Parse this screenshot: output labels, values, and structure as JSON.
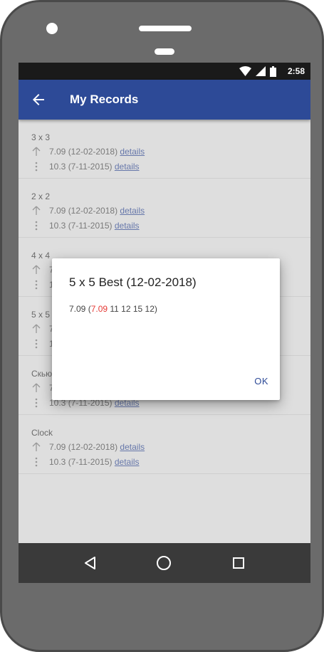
{
  "status_bar": {
    "time": "2:58",
    "icons": [
      "wifi-icon",
      "signal-icon",
      "battery-icon"
    ]
  },
  "app_bar": {
    "title": "My Records",
    "back_icon": "arrow-left-icon"
  },
  "records": [
    {
      "name": "3 x 3",
      "best_icon": "arrow-up-icon",
      "best_text": "7.09 (12-02-2018)",
      "best_link": "details",
      "avg_icon": "more-vert-icon",
      "avg_text": "10.3 (7-11-2015)",
      "avg_link": "details"
    },
    {
      "name": "2 x 2",
      "best_icon": "arrow-up-icon",
      "best_text": "7.09 (12-02-2018)",
      "best_link": "details",
      "avg_icon": "more-vert-icon",
      "avg_text": "10.3 (7-11-2015)",
      "avg_link": "details"
    },
    {
      "name": "4 x 4",
      "best_icon": "arrow-up-icon",
      "best_text": "7",
      "best_link": "",
      "avg_icon": "more-vert-icon",
      "avg_text": "1",
      "avg_link": ""
    },
    {
      "name": "5 x 5",
      "best_icon": "arrow-up-icon",
      "best_text": "7",
      "best_link": "",
      "avg_icon": "more-vert-icon",
      "avg_text": "1",
      "avg_link": ""
    },
    {
      "name": "Скьюб",
      "best_icon": "arrow-up-icon",
      "best_text": "7",
      "best_link": "",
      "avg_icon": "more-vert-icon",
      "avg_text": "10.3 (7-11-2015)",
      "avg_link": "details"
    },
    {
      "name": "Clock",
      "best_icon": "arrow-up-icon",
      "best_text": "7.09 (12-02-2018)",
      "best_link": "details",
      "avg_icon": "more-vert-icon",
      "avg_text": "10.3 (7-11-2015)",
      "avg_link": "details"
    }
  ],
  "dialog": {
    "title": "5 x 5 Best (12-02-2018)",
    "body_prefix": "7.09 (",
    "body_highlight": "7.09",
    "body_rest": " 11 12 15 12)",
    "ok_label": "OK",
    "highlight_color": "#e53935"
  },
  "nav_bar": {
    "icons": [
      "back-triangle-icon",
      "home-circle-icon",
      "recents-square-icon"
    ]
  },
  "colors": {
    "primary": "#2d4a97",
    "status_bar": "#1a1a1a",
    "nav_bar": "#3a3a3a",
    "link": "#6677aa"
  }
}
